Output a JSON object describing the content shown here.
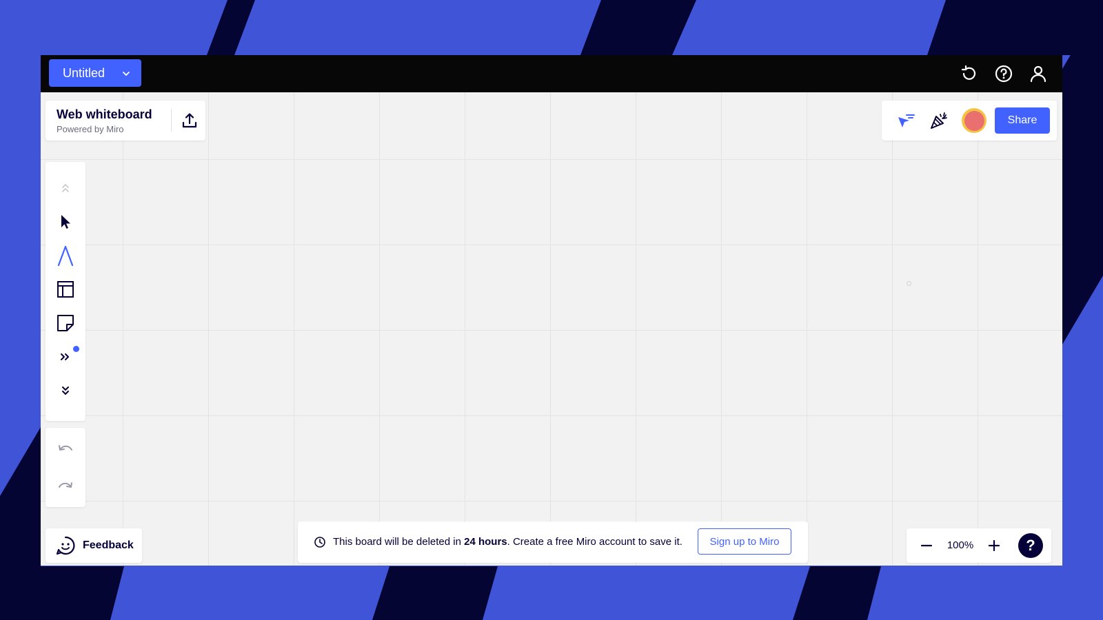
{
  "colors": {
    "accent": "#4262ff",
    "background_blue": "#4054d8",
    "background_navy": "#050533",
    "topbar": "#070707",
    "canvas": "#f2f2f2",
    "text_dark": "#050038"
  },
  "topbar": {
    "board_title": "Untitled",
    "icons": [
      "history-icon",
      "help-circle-icon",
      "user-icon"
    ]
  },
  "board_info": {
    "name": "Web whiteboard",
    "subtitle": "Powered by Miro",
    "icon": "upload-icon"
  },
  "right_panel": {
    "icons": [
      "cursor-filter-icon",
      "celebrate-icon"
    ],
    "share_label": "Share"
  },
  "toolbar": {
    "tools": [
      "collapse-up-icon",
      "select-cursor-icon",
      "text-font-icon",
      "template-frame-icon",
      "sticky-note-icon",
      "more-tools-icon",
      "expand-down-icon"
    ]
  },
  "history": {
    "icons": [
      "undo-icon",
      "redo-icon"
    ]
  },
  "feedback": {
    "label": "Feedback",
    "icon": "smiley-icon"
  },
  "notice": {
    "prefix": "This board will be deleted in ",
    "emphasis": "24 hours",
    "suffix": ". Create a free Miro account to save it.",
    "signup_label": "Sign up to Miro"
  },
  "zoom": {
    "level": "100%",
    "help_label": "?"
  }
}
